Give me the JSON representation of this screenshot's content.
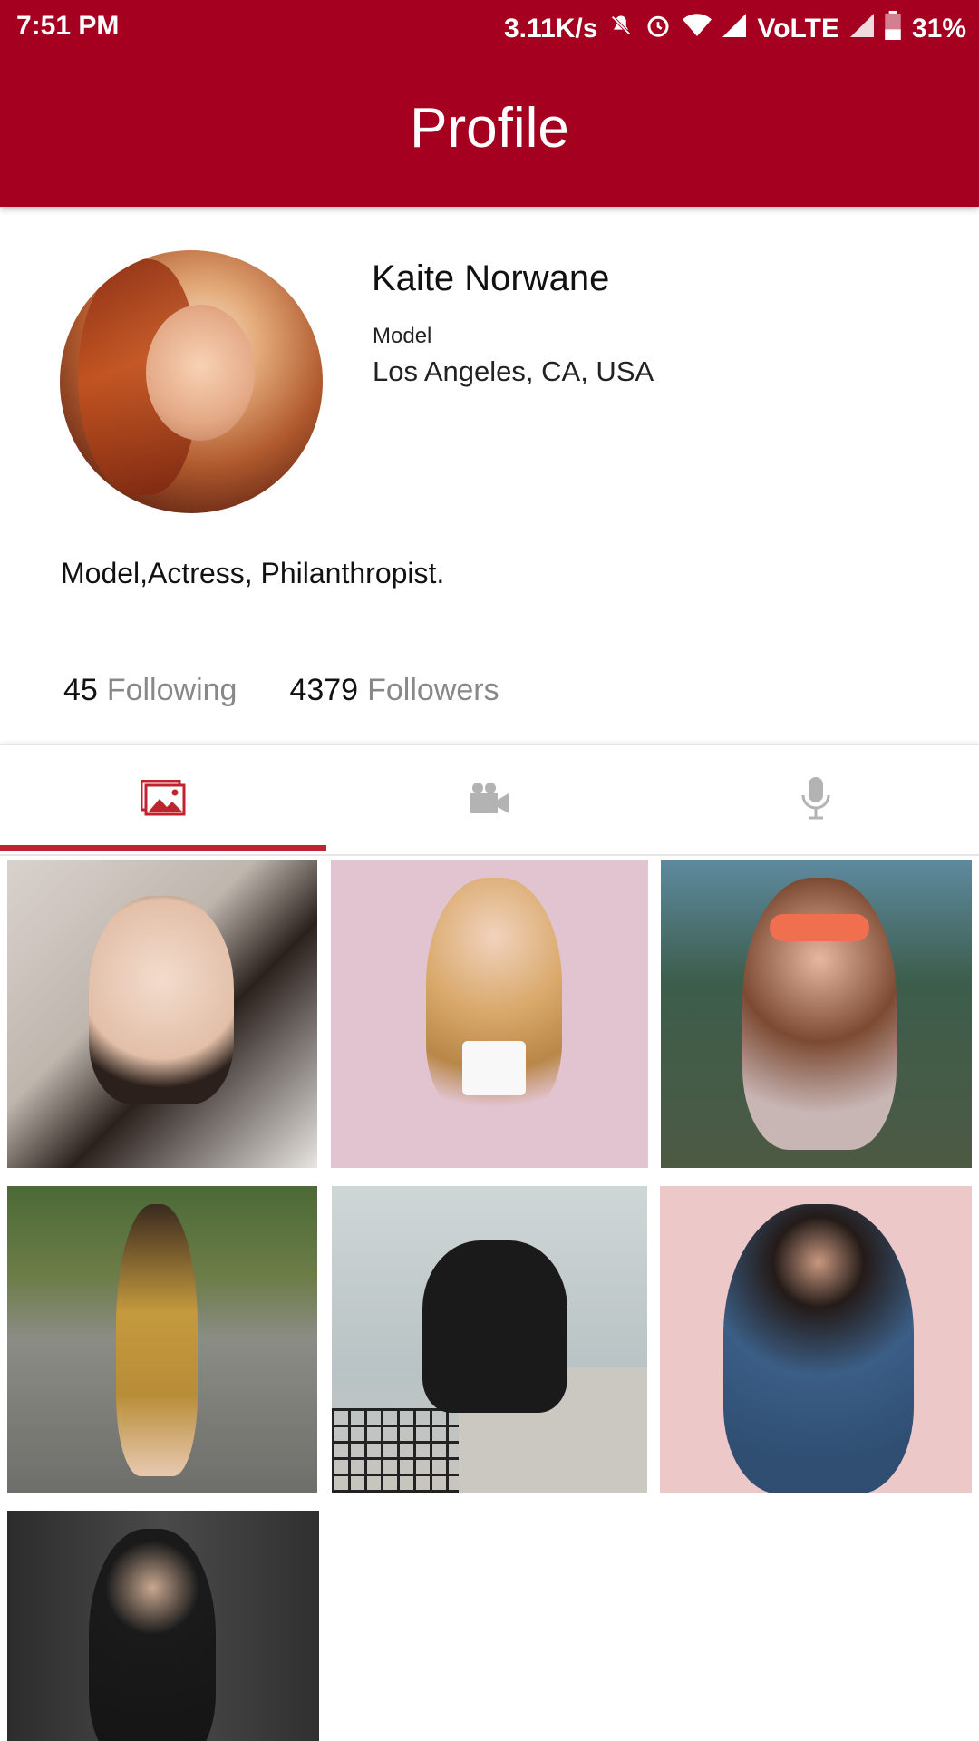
{
  "status_bar": {
    "time": "7:51 PM",
    "speed": "3.11K/s",
    "network": "VoLTE",
    "battery": "31%"
  },
  "app_bar": {
    "title": "Profile"
  },
  "profile": {
    "name": "Kaite Norwane",
    "role": "Model",
    "location": "Los Angeles, CA, USA",
    "bio": "Model,Actress, Philanthropist."
  },
  "stats": {
    "following_count": "45",
    "following_label": "Following",
    "followers_count": "4379",
    "followers_label": "Followers"
  },
  "tabs": [
    {
      "icon": "photos-icon",
      "active": true
    },
    {
      "icon": "video-camera-icon",
      "active": false
    },
    {
      "icon": "microphone-icon",
      "active": false
    }
  ],
  "colors": {
    "primary": "#a50020",
    "accent": "#c0222e",
    "inactive_icon": "#b3b3b3"
  },
  "gallery": [
    {
      "name": "gallery-photo-1"
    },
    {
      "name": "gallery-photo-2"
    },
    {
      "name": "gallery-photo-3"
    },
    {
      "name": "gallery-photo-4"
    },
    {
      "name": "gallery-photo-5"
    },
    {
      "name": "gallery-photo-6"
    },
    {
      "name": "gallery-photo-7"
    }
  ]
}
